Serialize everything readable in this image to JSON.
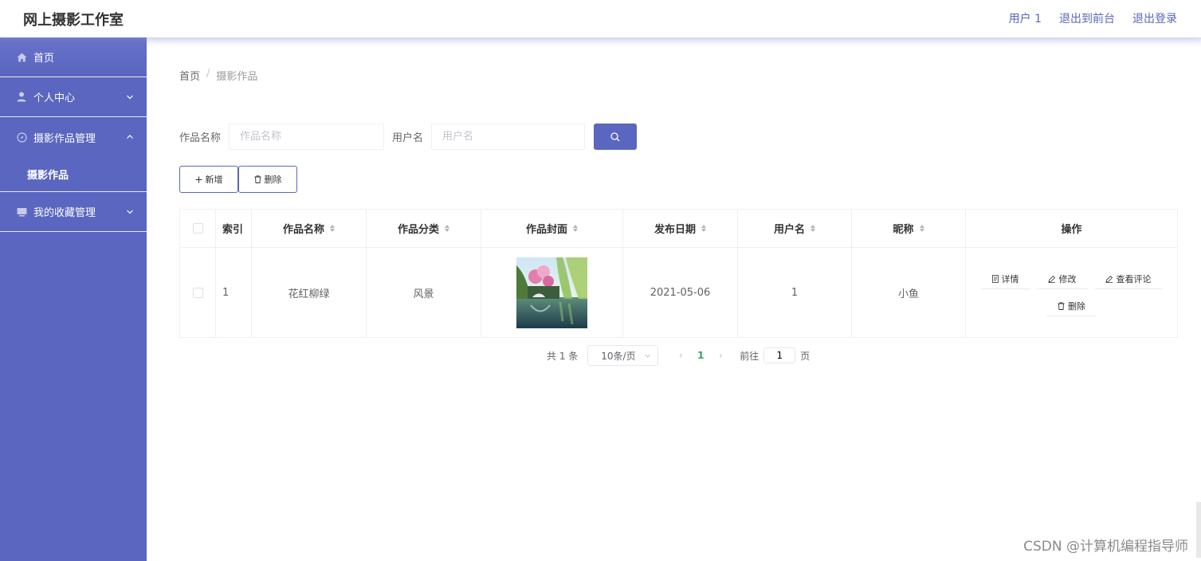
{
  "header": {
    "title": "网上摄影工作室",
    "links": [
      "用户 1",
      "退出到前台",
      "退出登录"
    ]
  },
  "sidebar": {
    "items": [
      {
        "label": "首页",
        "icon": "home-icon"
      },
      {
        "label": "个人中心",
        "icon": "user-icon"
      },
      {
        "label": "摄影作品管理",
        "icon": "compass-icon",
        "expanded": true,
        "children": [
          {
            "label": "摄影作品"
          }
        ]
      },
      {
        "label": "我的收藏管理",
        "icon": "folder-icon"
      }
    ]
  },
  "breadcrumb": {
    "home": "首页",
    "separator": "/",
    "current": "摄影作品"
  },
  "search": {
    "name_label": "作品名称",
    "name_placeholder": "作品名称",
    "user_label": "用户名",
    "user_placeholder": "用户名"
  },
  "actions": {
    "add": "新增",
    "delete": "删除"
  },
  "table": {
    "headers": [
      "索引",
      "作品名称",
      "作品分类",
      "作品封面",
      "发布日期",
      "用户名",
      "昵称",
      "操作"
    ],
    "rows": [
      {
        "index": "1",
        "name": "花红柳绿",
        "category": "风景",
        "date": "2021-05-06",
        "username": "1",
        "nickname": "小鱼"
      }
    ],
    "row_ops": {
      "detail": "详情",
      "edit": "修改",
      "comments": "查看评论",
      "delete": "删除"
    }
  },
  "pagination": {
    "total": "共 1 条",
    "page_size": "10条/页",
    "current_page": "1",
    "goto_label": "前往",
    "goto_value": "1",
    "page_unit": "页"
  },
  "watermark": "CSDN @计算机编程指导师",
  "colors": {
    "primary": "#5a66bf",
    "active_page": "#2fa36b"
  }
}
